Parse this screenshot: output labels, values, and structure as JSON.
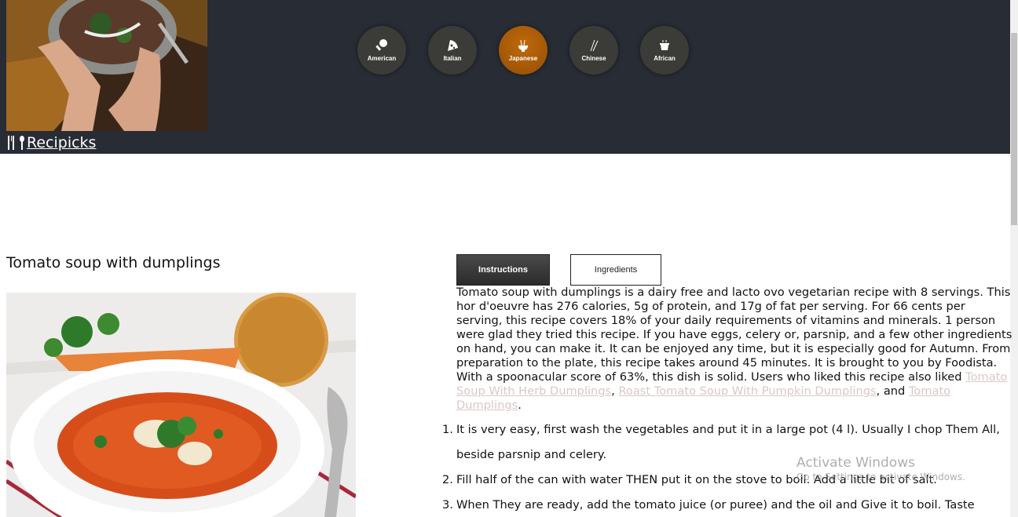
{
  "brand": {
    "name": "Recipicks",
    "icon": "cutlery-icon"
  },
  "cuisines": [
    {
      "label": "American",
      "icon": "drumstick-icon",
      "active": false
    },
    {
      "label": "Italian",
      "icon": "pizza-icon",
      "active": false
    },
    {
      "label": "Japanese",
      "icon": "ramen-icon",
      "active": true
    },
    {
      "label": "Chinese",
      "icon": "chopsticks-icon",
      "active": false
    },
    {
      "label": "African",
      "icon": "pot-icon",
      "active": false
    }
  ],
  "recipe": {
    "title": "Tomato soup with dumplings",
    "tabs": {
      "instructions": "Instructions",
      "ingredients": "Ingredients"
    },
    "summary_text": "Tomato soup with dumplings is a dairy free and lacto ovo vegetarian recipe with 8 servings. This hor d'oeuvre has 276 calories, 5g of protein, and 17g of fat per serving. For 66 cents per serving, this recipe covers 18% of your daily requirements of vitamins and minerals. 1 person were glad they tried this recipe. If you have eggs, celery or, parsnip, and a few other ingredients on hand, you can make it. It can be enjoyed any time, but it is especially good for Autumn. From preparation to the plate, this recipe takes around 45 minutes. It is brought to you by Foodista. With a spoonacular score of 63%, this dish is solid. Users who liked this recipe also liked ",
    "related": {
      "link1": "Tomato Soup With Herb Dumplings",
      "sep1": ", ",
      "link2": "Roast Tomato Soup With Pumpkin Dumplings",
      "sep2": ", and ",
      "link3": "Tomato Dumplings",
      "end": "."
    },
    "steps": [
      {
        "num": "1.",
        "text": "It is very easy, first wash the vegetables and put it in a large pot (4 l). Usually I chop Them All, beside parsnip and celery."
      },
      {
        "num": "2.",
        "text": "Fill half of the can with water THEN put it on the stove to boil. Add a little bit of salt."
      },
      {
        "num": "3.",
        "text": "When They are ready, add the tomato juice (or puree) and the oil and Give it to boil. Taste"
      }
    ]
  },
  "watermark": {
    "line1": "Activate Windows",
    "line2": "Go to Settings to activate Windows."
  },
  "colors": {
    "header_bg": "#282c34",
    "active_cuisine": "#a15605",
    "cuisine_bg": "#3b3b38",
    "link": "#d8c9c6"
  }
}
